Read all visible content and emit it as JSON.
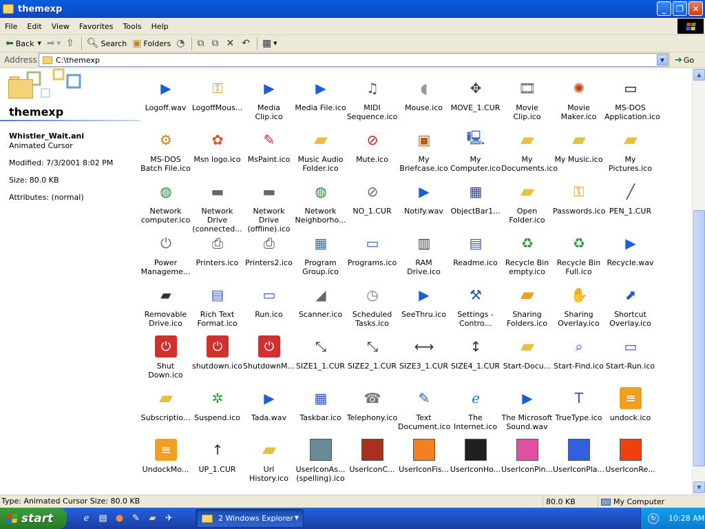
{
  "window": {
    "title": "themexp"
  },
  "menu": [
    "File",
    "Edit",
    "View",
    "Favorites",
    "Tools",
    "Help"
  ],
  "toolbar": {
    "back": "Back",
    "search": "Search",
    "folders": "Folders"
  },
  "address": {
    "label": "Address",
    "value": "C:\\themexp",
    "go": "Go"
  },
  "details": {
    "folder_title": "themexp",
    "file_name": "Whistler_Wait.ani",
    "file_type": "Animated Cursor",
    "modified": "Modified: 7/3/2001 8:02 PM",
    "size": "Size: 80.0 KB",
    "attributes": "Attributes: (normal)"
  },
  "files": [
    {
      "label": "Logoff.wav",
      "icon": "media-icon"
    },
    {
      "label": "LogoffMous...",
      "icon": "key-icon"
    },
    {
      "label": "Media Clip.ico",
      "icon": "media-icon"
    },
    {
      "label": "Media File.ico",
      "icon": "media-icon"
    },
    {
      "label": "MIDI Sequence.ico",
      "icon": "music-note-icon"
    },
    {
      "label": "Mouse.ico",
      "icon": "mouse-icon"
    },
    {
      "label": "MOVE_1.CUR",
      "icon": "move-cursor-icon"
    },
    {
      "label": "Movie Clip.ico",
      "icon": "film-icon"
    },
    {
      "label": "Movie Maker.ico",
      "icon": "movie-maker-icon"
    },
    {
      "label": "MS-DOS Application.ico",
      "icon": "console-icon"
    },
    {
      "label": "MS-DOS Batch File.ico",
      "icon": "gear-icon"
    },
    {
      "label": "Msn logo.ico",
      "icon": "butterfly-icon"
    },
    {
      "label": "MsPaint.ico",
      "icon": "paint-icon"
    },
    {
      "label": "Music Audio Folder.ico",
      "icon": "folder-icon"
    },
    {
      "label": "Mute.ico",
      "icon": "mute-icon"
    },
    {
      "label": "My Briefcase.ico",
      "icon": "briefcase-icon"
    },
    {
      "label": "My Computer.ico",
      "icon": "computer-icon"
    },
    {
      "label": "My Documents.ico",
      "icon": "folder-icon"
    },
    {
      "label": "My Music.ico",
      "icon": "folder-icon"
    },
    {
      "label": "My Pictures.ico",
      "icon": "folder-icon"
    },
    {
      "label": "Network computer.ico",
      "icon": "globe-icon"
    },
    {
      "label": "Network Drive (connected...",
      "icon": "drive-icon"
    },
    {
      "label": "Network Drive (offline).ico",
      "icon": "drive-icon"
    },
    {
      "label": "Network Neighborho...",
      "icon": "globe-icon"
    },
    {
      "label": "NO_1.CUR",
      "icon": "no-cursor-icon"
    },
    {
      "label": "Notify.wav",
      "icon": "media-icon"
    },
    {
      "label": "ObjectBar1...",
      "icon": "objectbar-icon"
    },
    {
      "label": "Open Folder.ico",
      "icon": "folder-icon"
    },
    {
      "label": "Passwords.ico",
      "icon": "key-icon"
    },
    {
      "label": "PEN_1.CUR",
      "icon": "pen-icon"
    },
    {
      "label": "Power Manageme...",
      "icon": "power-icon"
    },
    {
      "label": "Printers.ico",
      "icon": "printer-icon"
    },
    {
      "label": "Printers2.ico",
      "icon": "printer-icon"
    },
    {
      "label": "Program Group.ico",
      "icon": "program-group-icon"
    },
    {
      "label": "Programs.ico",
      "icon": "window-icon"
    },
    {
      "label": "RAM Drive.ico",
      "icon": "ram-icon"
    },
    {
      "label": "Readme.ico",
      "icon": "document-icon"
    },
    {
      "label": "Recycle Bin empty.ico",
      "icon": "recycle-bin-icon"
    },
    {
      "label": "Recycle Bin Full.ico",
      "icon": "recycle-bin-icon"
    },
    {
      "label": "Recycle.wav",
      "icon": "media-icon"
    },
    {
      "label": "Removable Drive.ico",
      "icon": "removable-drive-icon"
    },
    {
      "label": "Rich Text Format.ico",
      "icon": "document-icon"
    },
    {
      "label": "Run.ico",
      "icon": "run-icon"
    },
    {
      "label": "Scanner.ico",
      "icon": "scanner-icon"
    },
    {
      "label": "Scheduled Tasks.ico",
      "icon": "clock-icon"
    },
    {
      "label": "SeeThru.ico",
      "icon": "media-icon"
    },
    {
      "label": "Settings - Contro...",
      "icon": "settings-icon"
    },
    {
      "label": "Sharing Folders.ico",
      "icon": "sharing-folder-icon"
    },
    {
      "label": "Sharing Overlay.ico",
      "icon": "hand-icon"
    },
    {
      "label": "Shortcut Overlay.ico",
      "icon": "shortcut-arrow-icon"
    },
    {
      "label": "Shut Down.ico",
      "icon": "shutdown-icon"
    },
    {
      "label": "shutdown.ico",
      "icon": "shutdown-icon"
    },
    {
      "label": "ShutdownM...",
      "icon": "shutdown-icon"
    },
    {
      "label": "SIZE1_1.CUR",
      "icon": "resize-diagonal-icon"
    },
    {
      "label": "SIZE2_1.CUR",
      "icon": "resize-diagonal-icon"
    },
    {
      "label": "SIZE3_1.CUR",
      "icon": "resize-horizontal-icon"
    },
    {
      "label": "SIZE4_1.CUR",
      "icon": "resize-vertical-icon"
    },
    {
      "label": "Start-Docu...",
      "icon": "folder-icon"
    },
    {
      "label": "Start-Find.ico",
      "icon": "magnifier-icon"
    },
    {
      "label": "Start-Run.ico",
      "icon": "run-icon"
    },
    {
      "label": "Subscriptio...",
      "icon": "folder-icon"
    },
    {
      "label": "Suspend.ico",
      "icon": "suspend-icon"
    },
    {
      "label": "Tada.wav",
      "icon": "media-icon"
    },
    {
      "label": "Taskbar.ico",
      "icon": "taskbar-icon"
    },
    {
      "label": "Telephony.ico",
      "icon": "phone-icon"
    },
    {
      "label": "Text Document.ico",
      "icon": "notepad-icon"
    },
    {
      "label": "The Internet.ico",
      "icon": "internet-explorer-icon"
    },
    {
      "label": "The Microsoft Sound.wav",
      "icon": "media-icon"
    },
    {
      "label": "TrueType.ico",
      "icon": "truetype-icon"
    },
    {
      "label": "undock.ico",
      "icon": "undock-icon"
    },
    {
      "label": "UndockMo...",
      "icon": "undock-icon"
    },
    {
      "label": "UP_1.CUR",
      "icon": "up-arrow-icon"
    },
    {
      "label": "Url History.ico",
      "icon": "folder-icon"
    },
    {
      "label": "UserIconAs... (spelling).ico",
      "icon": "user-picture-icon"
    },
    {
      "label": "UserIconC...",
      "icon": "user-picture-icon"
    },
    {
      "label": "UserIconFis...",
      "icon": "user-picture-icon"
    },
    {
      "label": "UserIconHo...",
      "icon": "user-picture-icon"
    },
    {
      "label": "UserIconPin...",
      "icon": "user-picture-icon"
    },
    {
      "label": "UserIconPla...",
      "icon": "user-picture-icon"
    },
    {
      "label": "UserIconRe...",
      "icon": "user-picture-icon"
    }
  ],
  "status": {
    "info": "Type: Animated Cursor Size: 80.0 KB",
    "size": "80.0 KB",
    "location": "My Computer"
  },
  "taskbar": {
    "start": "start",
    "group": "2 Windows Explorer",
    "clock": "10:28 AM"
  },
  "colors": {
    "title_blue": "#0a5fd8",
    "start_green": "#3c9d3c",
    "tray_blue": "#0d8ee0",
    "folder_yellow": "#f6d46b"
  }
}
